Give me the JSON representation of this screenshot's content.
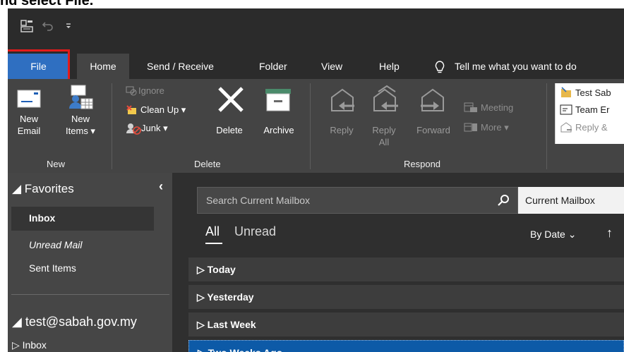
{
  "top_partial_text": "nd select File.",
  "tabs": [
    {
      "label": "File"
    },
    {
      "label": "Home"
    },
    {
      "label": "Send / Receive"
    },
    {
      "label": "Folder"
    },
    {
      "label": "View"
    },
    {
      "label": "Help"
    }
  ],
  "tell_me": "Tell me what you want to do",
  "ribbon": {
    "new": {
      "group_label": "New",
      "new_email": {
        "line1": "New",
        "line2": "Email"
      },
      "new_items": {
        "line1": "New",
        "line2": "Items ▾"
      }
    },
    "delete": {
      "group_label": "Delete",
      "ignore": "Ignore",
      "clean_up": "Clean Up ▾",
      "junk": "Junk ▾",
      "delete": "Delete",
      "archive": "Archive"
    },
    "respond": {
      "group_label": "Respond",
      "reply": "Reply",
      "reply_all": {
        "line1": "Reply",
        "line2": "All"
      },
      "forward": "Forward",
      "meeting": "Meeting",
      "more": "More ▾"
    },
    "quick_steps": {
      "item1": "Test Sab",
      "item2": "Team Er",
      "item3": "Reply &"
    }
  },
  "nav": {
    "favorites_header": "◢ Favorites",
    "collapse_arrow": "‹",
    "favorites": [
      {
        "label": "Inbox"
      },
      {
        "label": "Unread Mail"
      },
      {
        "label": "Sent Items"
      }
    ],
    "account_header": "◢ test@sabah.gov.my",
    "account_items": [
      {
        "label": "▷ Inbox"
      }
    ]
  },
  "mail": {
    "search_placeholder": "Search Current Mailbox",
    "scope": "Current Mailbox",
    "filter_all": "All",
    "filter_unread": "Unread",
    "sort_label": "By Date ⌄",
    "sort_arrow": "↑",
    "groups": [
      {
        "label": "▷ Today"
      },
      {
        "label": "▷ Yesterday"
      },
      {
        "label": "▷ Last Week"
      },
      {
        "label": "▷ Two Weeks Ago"
      }
    ]
  },
  "colors": {
    "accent": "#2f6fc1",
    "highlight_box": "#e41b1b",
    "selected_group": "#0d5aa7"
  }
}
